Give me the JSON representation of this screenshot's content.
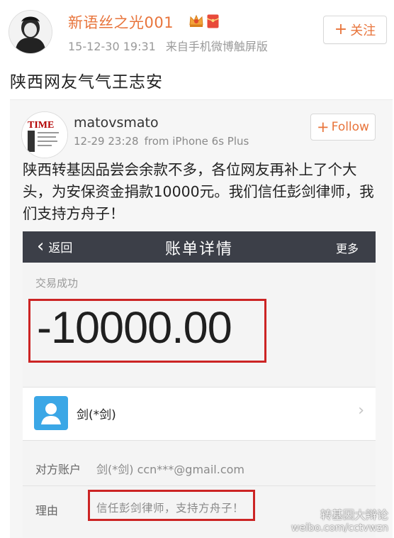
{
  "post": {
    "username": "新语丝之光001",
    "time": "15-12-30 19:31",
    "source": "来自手机微博触屏版",
    "follow_label": "关注",
    "follow_plus": "+",
    "text": "陕西网友气气王志安"
  },
  "repost": {
    "username": "matovsmato",
    "time": "12-29 23:28",
    "source": "from iPhone 6s Plus",
    "follow_label": "Follow",
    "follow_plus": "+",
    "text": "陕西转基因品尝会余款不多，各位网友再补上了个大头，为安保资金捐款10000元。我们信任彭剑律师，我们支持方舟子！"
  },
  "payment": {
    "back_label": "返回",
    "title": "账单详情",
    "more_label": "更多",
    "status": "交易成功",
    "amount": "-10000.00",
    "payee_name": "剑(*剑)",
    "account_label": "对方账户",
    "account_value": "剑(*剑) ccn***@gmail.com",
    "reason_label": "理由",
    "reason_value": "信任彭剑律师，支持方舟子！"
  },
  "watermark": {
    "line1": "转基因大辩论",
    "line2": "weibo.com/cctvwzn"
  },
  "colors": {
    "accent": "#e8743b",
    "nav_bg": "#3c3f48",
    "highlight_border": "#cc2424",
    "payee_icon": "#3ba7e6"
  },
  "icons": [
    "user-avatar",
    "crown-icon",
    "red-envelope-icon",
    "chevron-left-icon",
    "person-icon",
    "chevron-right-icon"
  ]
}
